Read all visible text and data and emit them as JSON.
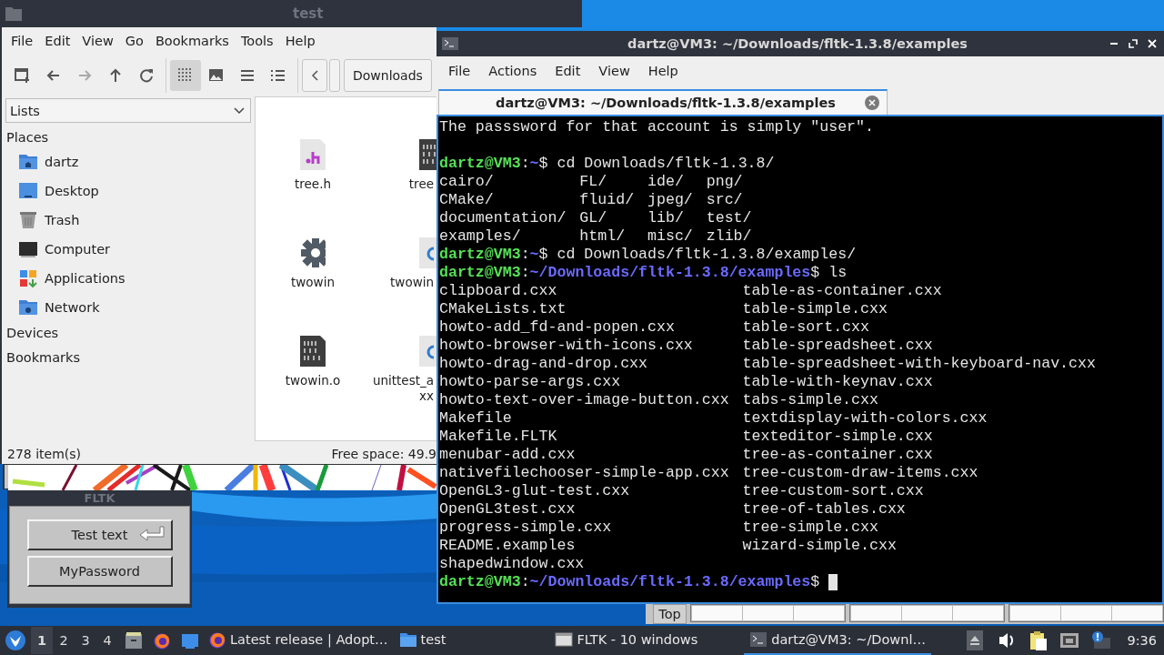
{
  "file_manager": {
    "title": "test",
    "menu": [
      "File",
      "Edit",
      "View",
      "Go",
      "Bookmarks",
      "Tools",
      "Help"
    ],
    "nav_buttons": [
      {
        "kind": "new_tab",
        "disabled": false
      },
      {
        "kind": "back",
        "disabled": false
      },
      {
        "kind": "forward",
        "disabled": true
      },
      {
        "kind": "up",
        "disabled": false
      },
      {
        "kind": "reload",
        "disabled": false
      }
    ],
    "view_buttons": [
      {
        "kind": "icons",
        "selected": true
      },
      {
        "kind": "thumbnails",
        "selected": false
      },
      {
        "kind": "compact",
        "selected": false
      },
      {
        "kind": "detailed",
        "selected": false
      }
    ],
    "path_bar": {
      "current": "Downloads"
    },
    "side_pane_mode": "Lists",
    "sections": [
      {
        "title": "Places",
        "items": [
          {
            "kind": "home",
            "label": "dartz"
          },
          {
            "kind": "desktop",
            "label": "Desktop"
          },
          {
            "kind": "trash",
            "label": "Trash"
          },
          {
            "kind": "computer",
            "label": "Computer"
          },
          {
            "kind": "applications",
            "label": "Applications"
          },
          {
            "kind": "network",
            "label": "Network"
          }
        ]
      },
      {
        "title": "Devices"
      },
      {
        "title": "Bookmarks"
      }
    ],
    "files": [
      {
        "kind": "header",
        "name": [
          "tree.h"
        ]
      },
      {
        "kind": "binary",
        "name": [
          "tree"
        ]
      },
      {
        "kind": "executable",
        "name": [
          "twowin"
        ]
      },
      {
        "kind": "cpp",
        "name": [
          "twowin"
        ]
      },
      {
        "kind": "binary",
        "name": [
          "twowin.o"
        ]
      },
      {
        "kind": "cpp",
        "name": [
          "unittest_a",
          "xx"
        ]
      }
    ],
    "status": {
      "items": "278 item(s)",
      "free_space": "Free space: 49.9"
    }
  },
  "fltk_window": {
    "title": "FLTK",
    "buttons": [
      {
        "label": "Test text",
        "kind": "return"
      },
      {
        "label": "MyPassword",
        "kind": "plain"
      }
    ]
  },
  "background_window": {
    "button": "Top"
  },
  "terminal": {
    "title": "dartz@VM3: ~/Downloads/fltk-1.3.8/examples",
    "menu": [
      "File",
      "Actions",
      "Edit",
      "View",
      "Help"
    ],
    "tabs": [
      {
        "label": "dartz@VM3: ~/Downloads/fltk-1.3.8/examples",
        "selected": true
      }
    ],
    "lines": [
      {
        "kind": "text",
        "text": "The passsword for that account is simply \"user\"."
      },
      {
        "kind": "blank"
      },
      {
        "kind": "prompt",
        "cursor": false,
        "user": "dartz@VM3",
        "separator": ":",
        "path": "~",
        "command": "$ cd Downloads/fltk-1.3.8/"
      },
      {
        "kind": "listing",
        "rows": [
          [
            "cairo/",
            "FL/",
            "ide/",
            "png/"
          ],
          [
            "CMake/",
            "fluid/",
            "jpeg/",
            "src/"
          ],
          [
            "documentation/",
            "GL/",
            "lib/",
            "test/"
          ],
          [
            "examples/",
            "html/",
            "misc/",
            "zlib/"
          ]
        ]
      },
      {
        "kind": "prompt",
        "cursor": false,
        "user": "dartz@VM3",
        "separator": ":",
        "path": "~",
        "command": "$ cd Downloads/fltk-1.3.8/examples/"
      },
      {
        "kind": "prompt",
        "cursor": false,
        "user": "dartz@VM3",
        "separator": ":",
        "path": "~/Downloads/fltk-1.3.8/examples",
        "command": "$ ls"
      },
      {
        "kind": "listing",
        "rows": [
          [
            "clipboard.cxx",
            "table-as-container.cxx"
          ],
          [
            "CMakeLists.txt",
            "table-simple.cxx"
          ],
          [
            "howto-add_fd-and-popen.cxx",
            "table-sort.cxx"
          ],
          [
            "howto-browser-with-icons.cxx",
            "table-spreadsheet.cxx"
          ],
          [
            "howto-drag-and-drop.cxx",
            "table-spreadsheet-with-keyboard-nav.cxx"
          ],
          [
            "howto-parse-args.cxx",
            "table-with-keynav.cxx"
          ],
          [
            "howto-text-over-image-button.cxx",
            "tabs-simple.cxx"
          ],
          [
            "Makefile",
            "textdisplay-with-colors.cxx"
          ],
          [
            "Makefile.FLTK",
            "texteditor-simple.cxx"
          ],
          [
            "menubar-add.cxx",
            "tree-as-container.cxx"
          ],
          [
            "nativefilechooser-simple-app.cxx",
            "tree-custom-draw-items.cxx"
          ],
          [
            "OpenGL3-glut-test.cxx",
            "tree-custom-sort.cxx"
          ],
          [
            "OpenGL3test.cxx",
            "tree-of-tables.cxx"
          ],
          [
            "progress-simple.cxx",
            "tree-simple.cxx"
          ],
          [
            "README.examples",
            "wizard-simple.cxx"
          ],
          [
            "shapedwindow.cxx"
          ]
        ]
      },
      {
        "kind": "prompt",
        "cursor": true,
        "user": "dartz@VM3",
        "separator": ":",
        "path": "~/Downloads/fltk-1.3.8/examples",
        "command": "$"
      }
    ]
  },
  "taskbar": {
    "workspaces": [
      {
        "label": "1",
        "selected": true
      },
      {
        "label": "2",
        "selected": false
      },
      {
        "label": "3",
        "selected": false
      },
      {
        "label": "4",
        "selected": false
      }
    ],
    "launchers": [
      {
        "kind": "files"
      },
      {
        "kind": "browser"
      },
      {
        "kind": "desktop"
      }
    ],
    "tasks": [
      {
        "kind": "browser",
        "label": "Latest release | Adopt…",
        "selected": false
      },
      {
        "kind": "folder",
        "label": "test",
        "selected": false
      },
      {
        "kind": "window",
        "label": "FLTK - 10 windows",
        "selected": false
      },
      {
        "kind": "terminal",
        "label": "dartz@VM3: ~/Downl…",
        "selected": true
      }
    ],
    "tray": [
      {
        "kind": "eject"
      },
      {
        "kind": "volume"
      },
      {
        "kind": "clipboard"
      },
      {
        "kind": "network"
      },
      {
        "kind": "notification"
      }
    ],
    "clock": "9:36"
  }
}
